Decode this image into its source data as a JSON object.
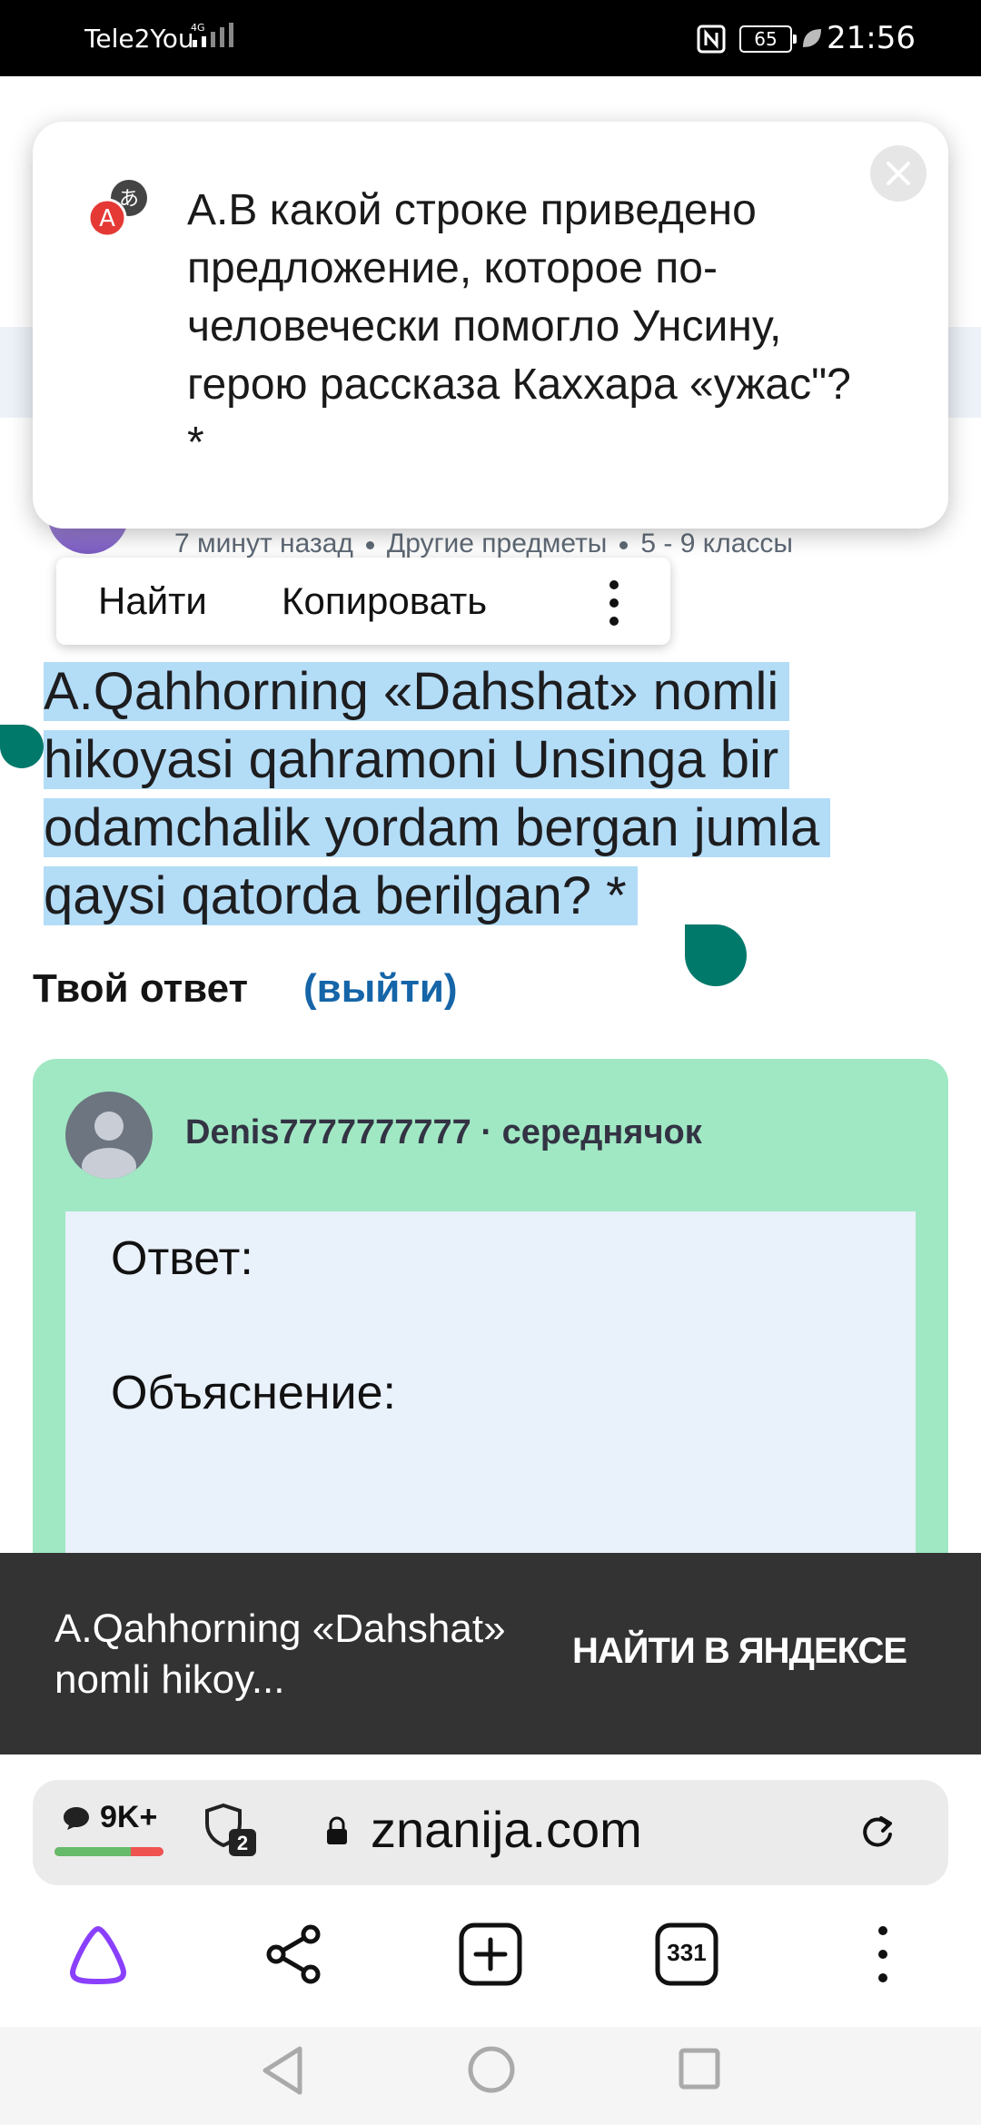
{
  "status_bar": {
    "carrier": "Tele2You",
    "network": "4G",
    "battery": "65",
    "time": "21:56"
  },
  "translation_popup": {
    "text": "А.В какой строке приведено предложение, которое по-человечески помогло Унсину, герою рассказа Каххара «ужас\"? *"
  },
  "question_meta": {
    "time_ago": "7 минут назад",
    "subject": "Другие предметы",
    "grade": "5 - 9 классы"
  },
  "context_menu": {
    "find": "Найти",
    "copy": "Копировать"
  },
  "question": {
    "text": "A.Qahhorning «Dahshat» nomli hikoyasi qahramoni Unsinga bir odamchalik yordam bergan jumla qaysi qatorda berilgan? *"
  },
  "answer_section": {
    "title": "Твой ответ",
    "exit": "(выйти)"
  },
  "answer_card": {
    "username": "Denis7777777777 · середнячок",
    "answer_label": "Ответ:",
    "explanation_label": "Объяснение:"
  },
  "yandex_bar": {
    "query": "A.Qahhorning «Dahshat» nomli hikoy...",
    "button": "НАЙТИ В ЯНДЕКСЕ"
  },
  "address_bar": {
    "comments": "9K+",
    "shield_count": "2",
    "url": "znanija.com",
    "rating_fraction": 0.7
  },
  "bottom_nav": {
    "tabs_count": "331"
  },
  "colors": {
    "selection": "#b3dcf7",
    "handle": "#00796b",
    "answer_card": "#a0e8c3",
    "link": "#1565a8",
    "alice": "#8a3ffc"
  }
}
